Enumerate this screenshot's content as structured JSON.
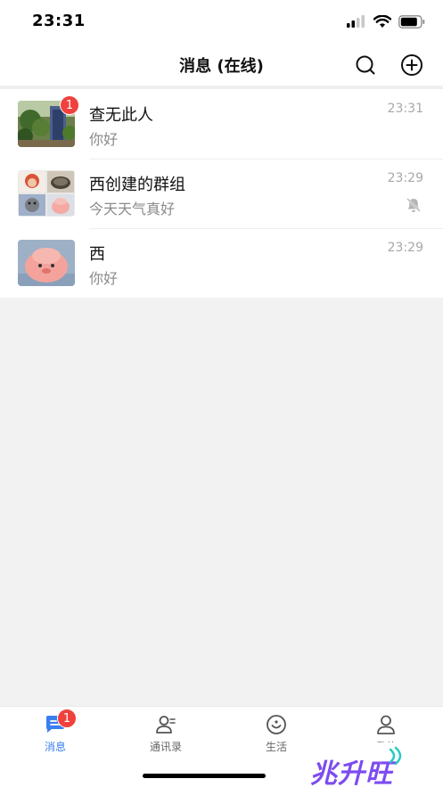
{
  "status_bar": {
    "time": "23:31"
  },
  "nav": {
    "title": "消息 (在线)"
  },
  "chats": [
    {
      "name": "查无此人",
      "preview": "你好",
      "time": "23:31",
      "unread": "1",
      "muted": false
    },
    {
      "name": "西创建的群组",
      "preview": "今天天气真好",
      "time": "23:29",
      "unread": "",
      "muted": true
    },
    {
      "name": "西",
      "preview": "你好",
      "time": "23:29",
      "unread": "",
      "muted": false
    }
  ],
  "tabs": [
    {
      "label": "消息",
      "badge": "1",
      "icon": "chat-bubble-icon",
      "active": true
    },
    {
      "label": "通讯录",
      "icon": "contacts-icon",
      "active": false
    },
    {
      "label": "生活",
      "icon": "smile-icon",
      "active": false
    },
    {
      "label": "我的",
      "icon": "person-icon",
      "active": false
    }
  ],
  "watermark": {
    "text": "兆升旺"
  },
  "colors": {
    "accent": "#3a7ef0",
    "badge": "#f0413c",
    "watermark": "#7d4cf0"
  }
}
